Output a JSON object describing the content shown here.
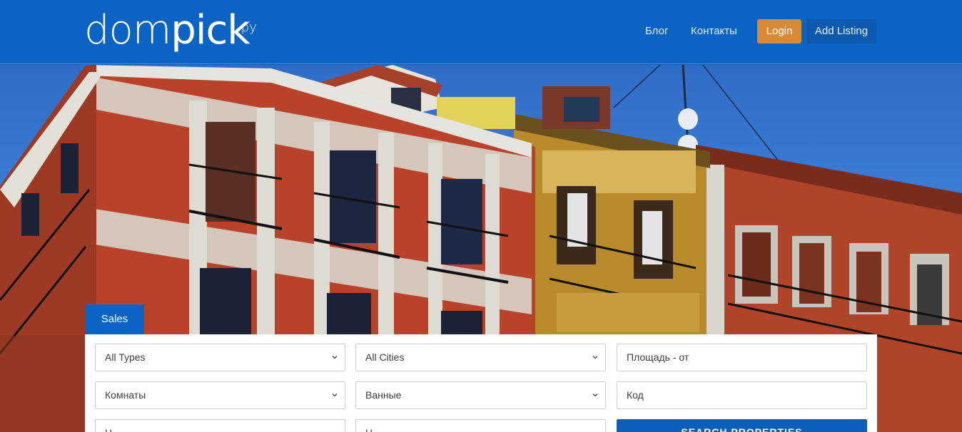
{
  "brand": {
    "name_light": "dom",
    "name_bold": "pick",
    "tld": ".ру"
  },
  "nav": {
    "blog": "Блог",
    "contacts": "Контакты",
    "login": "Login",
    "add_listing": "Add Listing"
  },
  "search": {
    "tab": "Sales",
    "type_select": "All Types",
    "city_select": "All Cities",
    "area_from_placeholder": "Площадь - от",
    "rooms_select": "Комнаты",
    "baths_select": "Ванные",
    "code_placeholder": "Код",
    "row3_left": "Ц",
    "row3_middle": "Ц",
    "search_button": "SEARCH PROPERTIES"
  },
  "colors": {
    "header_bg": "#0b63c3",
    "login_bg": "#d98a36",
    "accent": "#0b5fb9"
  }
}
